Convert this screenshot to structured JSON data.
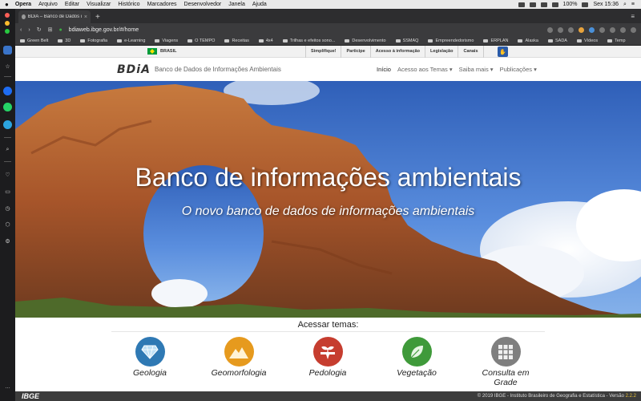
{
  "mac_menubar": {
    "app": "Opera",
    "items": [
      "Arquivo",
      "Editar",
      "Visualizar",
      "Histórico",
      "Marcadores",
      "Desenvolvedor",
      "Janela",
      "Ajuda"
    ],
    "battery": "100%",
    "clock": "Sex 15:36"
  },
  "browser": {
    "tab_title": "BDiA – Banco de Dados de Info",
    "url": "bdiaweb.ibge.gov.br/#/home",
    "bookmarks": [
      "Green Belt",
      "3D",
      "Fotografia",
      "e-Learning",
      "Viagens",
      "O TEMPO",
      "Receitas",
      "4x4",
      "Trilhas e efeitos sono...",
      "Desenvolvimento",
      "SSMAQ",
      "Empreendedorismo",
      "ERPLAN",
      "Alaska",
      "SADA",
      "Vídeos",
      "Temp"
    ]
  },
  "gov_bar": {
    "brasil": "BRASIL",
    "links": [
      "Simplifique!",
      "Participe",
      "Acesso à informação",
      "Legislação",
      "Canais"
    ]
  },
  "header": {
    "logo": "BDiA",
    "title": "Banco de Dados de Informações Ambientais",
    "nav": [
      "Início",
      "Acesso aos Temas ▾",
      "Saiba mais ▾",
      "Publicações ▾"
    ]
  },
  "hero": {
    "title": "Banco de informações ambientais",
    "subtitle": "O novo banco de dados de informações ambientais"
  },
  "temas": {
    "heading": "Acessar temas:",
    "items": [
      {
        "label": "Geologia",
        "color": "#2f79b4",
        "icon": "gem-icon"
      },
      {
        "label": "Geomorfologia",
        "color": "#e69a1e",
        "icon": "mountain-icon"
      },
      {
        "label": "Pedologia",
        "color": "#c63d2f",
        "icon": "soil-plant-icon"
      },
      {
        "label": "Vegetação",
        "color": "#3f9a3a",
        "icon": "leaf-icon"
      },
      {
        "label": "Consulta em Grade",
        "color": "#7f7f7f",
        "icon": "grid-icon"
      }
    ]
  },
  "footer": {
    "logo": "IBGE",
    "copyright": "© 2019 IBGE - Instituto Brasileiro de Geografia e Estatística - Versão",
    "version": "2.2.2"
  }
}
